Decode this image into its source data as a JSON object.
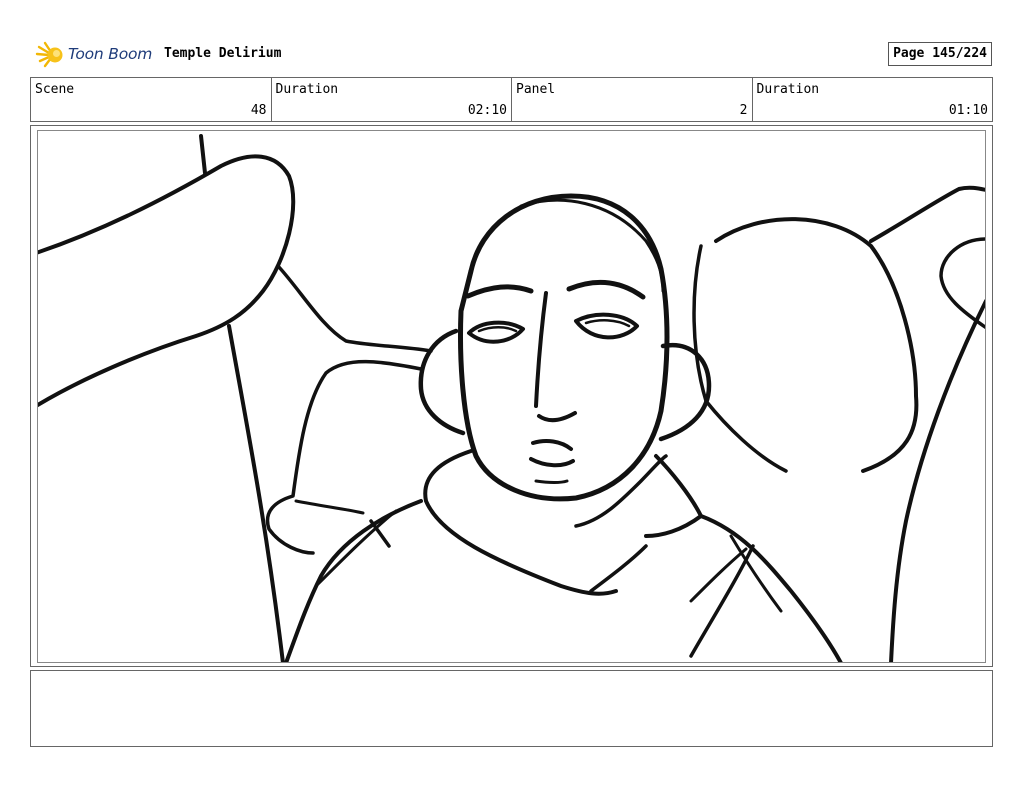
{
  "header": {
    "logo_text": "Toon Boom",
    "project_title": "Temple Delirium",
    "page": "Page 145/224"
  },
  "panel_info": [
    {
      "label": "Scene",
      "value": "48"
    },
    {
      "label": "Duration",
      "value": "02:10"
    },
    {
      "label": "Panel",
      "value": "2"
    },
    {
      "label": "Duration",
      "value": "01:10"
    }
  ],
  "drawing": {
    "icon": "sketch-character-closeup"
  },
  "notes": {
    "text": ""
  }
}
